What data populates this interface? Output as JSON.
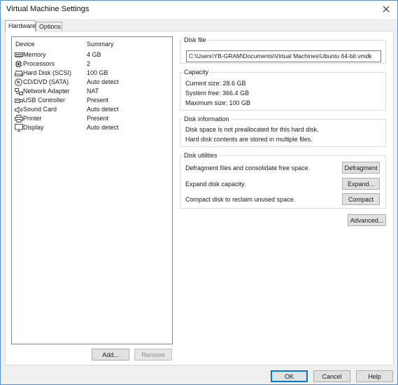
{
  "window": {
    "title": "Virtual Machine Settings"
  },
  "tabs": [
    {
      "label": "Hardware",
      "active": true
    },
    {
      "label": "Options",
      "active": false
    }
  ],
  "device_list": {
    "headers": {
      "device": "Device",
      "summary": "Summary"
    },
    "items": [
      {
        "icon": "memory-icon",
        "name": "Memory",
        "summary": "4 GB"
      },
      {
        "icon": "processor-icon",
        "name": "Processors",
        "summary": "2"
      },
      {
        "icon": "hard-disk-icon",
        "name": "Hard Disk (SCSI)",
        "summary": "100 GB"
      },
      {
        "icon": "cd-dvd-icon",
        "name": "CD/DVD (SATA)",
        "summary": "Auto detect"
      },
      {
        "icon": "network-adapter-icon",
        "name": "Network Adapter",
        "summary": "NAT"
      },
      {
        "icon": "usb-icon",
        "name": "USB Controller",
        "summary": "Present"
      },
      {
        "icon": "sound-card-icon",
        "name": "Sound Card",
        "summary": "Auto detect"
      },
      {
        "icon": "printer-icon",
        "name": "Printer",
        "summary": "Present"
      },
      {
        "icon": "display-icon",
        "name": "Display",
        "summary": "Auto detect"
      }
    ],
    "add_label": "Add...",
    "remove_label": "Remove"
  },
  "disk_file": {
    "title": "Disk file",
    "path": "C:\\Users\\YB-GRAM\\Documents\\Virtual Machines\\Ubuntu 64-bit.vmdk"
  },
  "capacity": {
    "title": "Capacity",
    "current_size": "Current size:  28.6 GB",
    "system_free": "System free:  366.4 GB",
    "maximum_size": "Maximum size:  100 GB"
  },
  "disk_information": {
    "title": "Disk information",
    "line1": "Disk space is not preallocated for this hard disk.",
    "line2": "Hard disk contents are stored in multiple files."
  },
  "disk_utilities": {
    "title": "Disk utilities",
    "defragment_text": "Defragment files and consolidate free space.",
    "defragment_label": "Defragment",
    "expand_text": "Expand disk capacity.",
    "expand_label": "Expand...",
    "compact_text": "Compact disk to reclaim unused space.",
    "compact_label": "Compact"
  },
  "advanced_label": "Advanced...",
  "footer": {
    "ok_label": "OK",
    "cancel_label": "Cancel",
    "help_label": "Help"
  }
}
